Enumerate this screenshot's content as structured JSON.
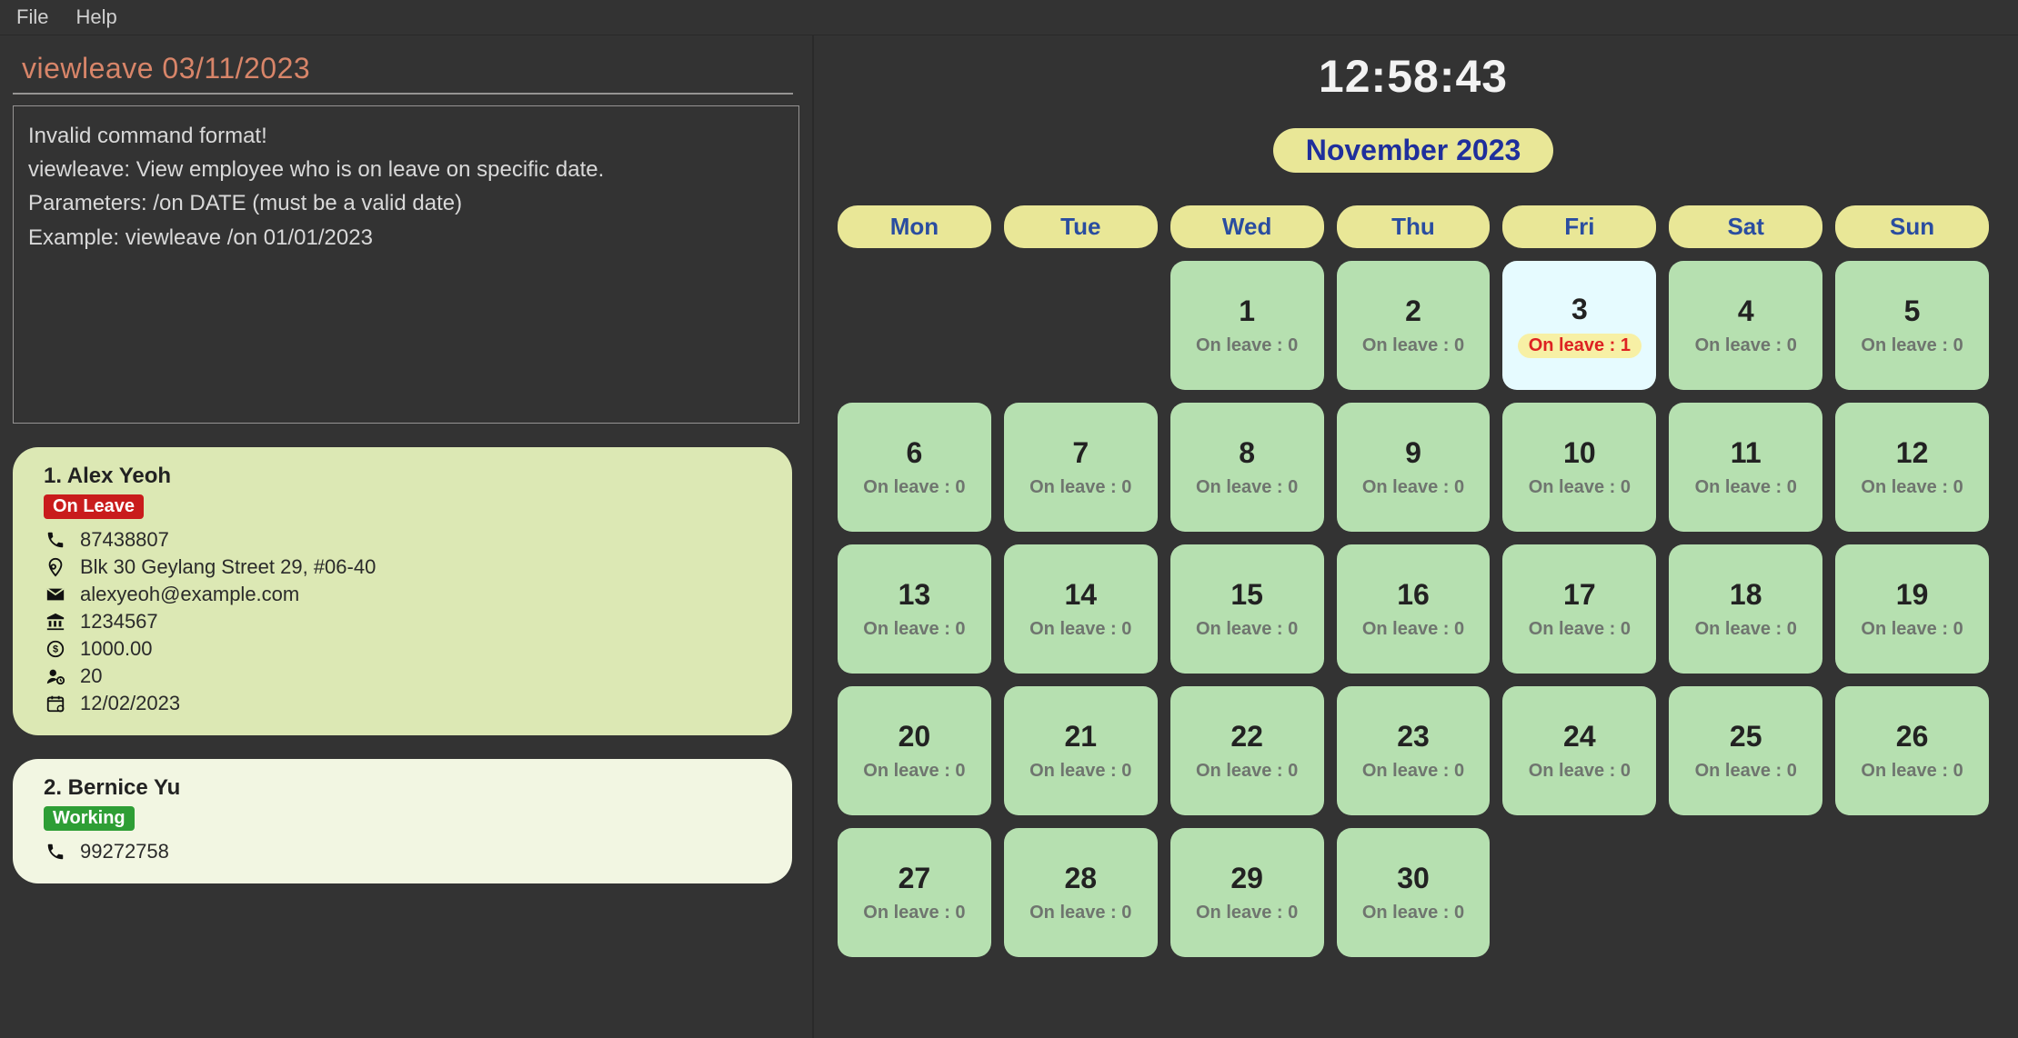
{
  "menu": {
    "file": "File",
    "help": "Help"
  },
  "command": {
    "value": "viewleave 03/11/2023"
  },
  "result": {
    "lines": [
      "Invalid command format!",
      "viewleave: View employee who is on leave on specific date.",
      "Parameters: /on DATE (must be a valid date)",
      "Example: viewleave /on 01/01/2023"
    ]
  },
  "clock": "12:58:43",
  "calendar": {
    "month_label": "November 2023",
    "weekdays": [
      "Mon",
      "Tue",
      "Wed",
      "Thu",
      "Fri",
      "Sat",
      "Sun"
    ],
    "first_weekday_index": 2,
    "days_in_month": 30,
    "today": 3,
    "leave_counts": {
      "1": 0,
      "2": 0,
      "3": 1,
      "4": 0,
      "5": 0,
      "6": 0,
      "7": 0,
      "8": 0,
      "9": 0,
      "10": 0,
      "11": 0,
      "12": 0,
      "13": 0,
      "14": 0,
      "15": 0,
      "16": 0,
      "17": 0,
      "18": 0,
      "19": 0,
      "20": 0,
      "21": 0,
      "22": 0,
      "23": 0,
      "24": 0,
      "25": 0,
      "26": 0,
      "27": 0,
      "28": 0,
      "29": 0,
      "30": 0
    },
    "leave_label_prefix": "On leave : "
  },
  "persons": [
    {
      "index": "1.",
      "name": "Alex Yeoh",
      "status": "On Leave",
      "status_kind": "onleave",
      "phone": "87438807",
      "address": "Blk 30 Geylang Street 29, #06-40",
      "email": "alexyeoh@example.com",
      "bank": "1234567",
      "salary": "1000.00",
      "leave_balance": "20",
      "dob": "12/02/2023"
    },
    {
      "index": "2.",
      "name": "Bernice Yu",
      "status": "Working",
      "status_kind": "working",
      "phone": "99272758",
      "address": "",
      "email": "",
      "bank": "",
      "salary": "",
      "leave_balance": "",
      "dob": ""
    }
  ]
}
